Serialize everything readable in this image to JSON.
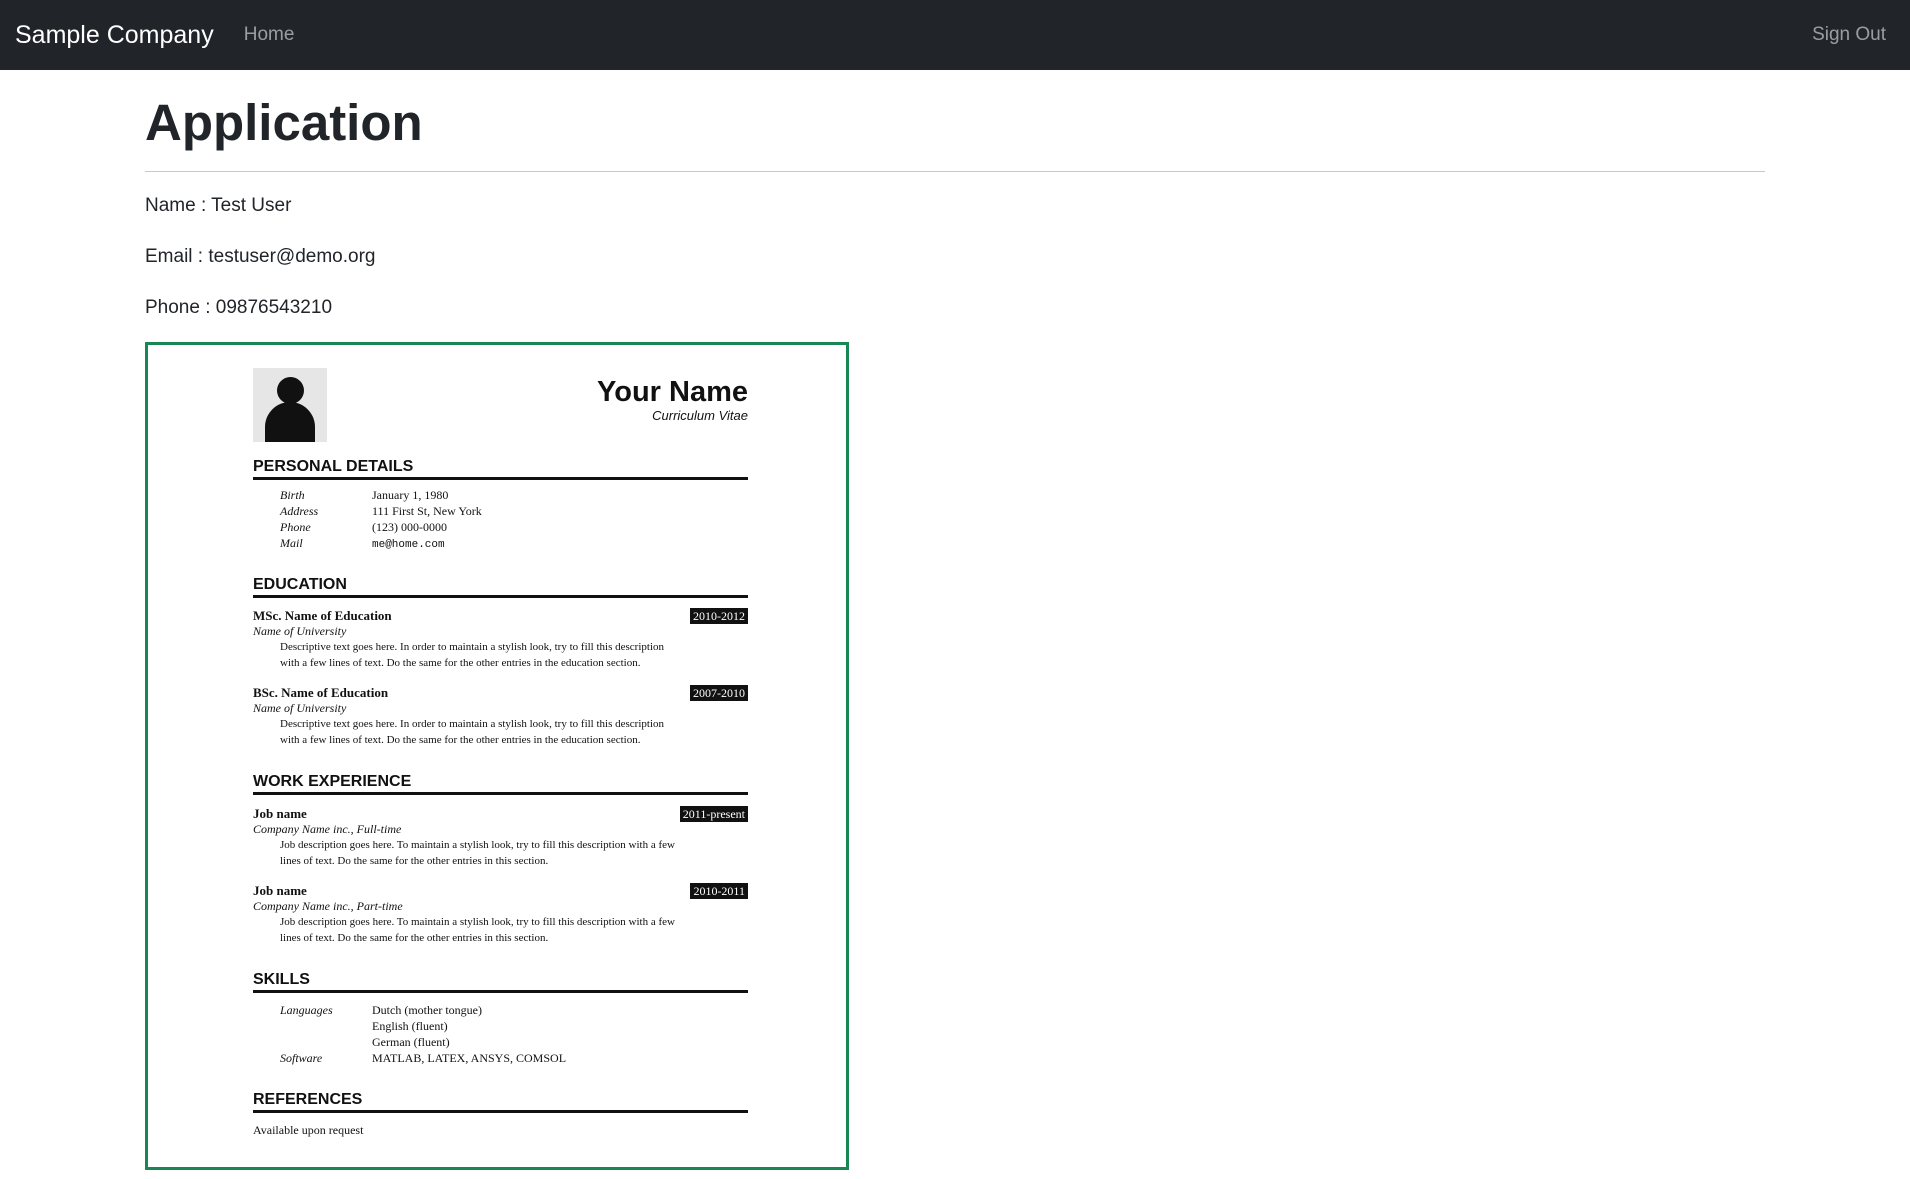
{
  "navbar": {
    "brand": "Sample Company",
    "home": "Home",
    "sign_out": "Sign Out"
  },
  "page": {
    "title": "Application",
    "name_line": "Name : Test User",
    "email_line": "Email : testuser@demo.org",
    "phone_line": "Phone : 09876543210"
  },
  "resume": {
    "name": "Your Name",
    "subtitle": "Curriculum Vitae",
    "sections": {
      "personal": "PERSONAL DETAILS",
      "education": "EDUCATION",
      "work": "WORK EXPERIENCE",
      "skills": "SKILLS",
      "references": "REFERENCES"
    },
    "personal": [
      {
        "key": "Birth",
        "value": "January 1, 1980"
      },
      {
        "key": "Address",
        "value": "111 First St, New York"
      },
      {
        "key": "Phone",
        "value": "(123) 000-0000"
      },
      {
        "key": "Mail",
        "value": "me@home.com"
      }
    ],
    "education": [
      {
        "title": "MSc. Name of Education",
        "org": "Name of University",
        "dates": "2010-2012",
        "desc1": "Descriptive text goes here. In order to maintain a stylish look, try to fill this description",
        "desc2": "with a few lines of text. Do the same for the other entries in the education section."
      },
      {
        "title": "BSc. Name of Education",
        "org": "Name of University",
        "dates": "2007-2010",
        "desc1": "Descriptive text goes here. In order to maintain a stylish look, try to fill this description",
        "desc2": "with a few lines of text. Do the same for the other entries in the education section."
      }
    ],
    "work": [
      {
        "title": "Job name",
        "org": "Company Name inc., Full-time",
        "dates": "2011-present",
        "desc1": "Job description goes here. To maintain a stylish look, try to fill this description with a few",
        "desc2": "lines of text. Do the same for the other entries in this section."
      },
      {
        "title": "Job name",
        "org": "Company Name inc., Part-time",
        "dates": "2010-2011",
        "desc1": "Job description goes here. To maintain a stylish look, try to fill this description with a few",
        "desc2": "lines of text. Do the same for the other entries in this section."
      }
    ],
    "skills": {
      "languages_key": "Languages",
      "languages": [
        "Dutch (mother tongue)",
        "English (fluent)",
        "German (fluent)"
      ],
      "software_key": "Software",
      "software": "MATLAB, LATEX, ANSYS, COMSOL"
    },
    "references_text": "Available upon request"
  },
  "colors": {
    "navbar_bg": "#212529",
    "frame_border": "#198754"
  }
}
